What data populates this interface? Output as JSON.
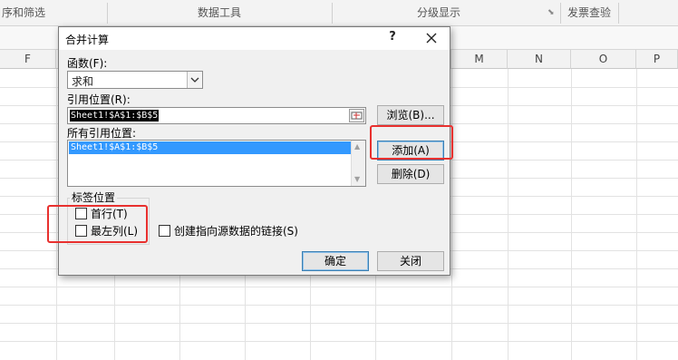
{
  "ribbon": {
    "groups": [
      "序和筛选",
      "数据工具",
      "分级显示",
      "发票查验"
    ]
  },
  "sheet": {
    "columns": [
      "F",
      "M",
      "N",
      "O",
      "P"
    ]
  },
  "dialog": {
    "title": "合并计算",
    "help": "?",
    "function_label": "函数(F):",
    "function_value": "求和",
    "reference_label": "引用位置(R):",
    "reference_value": "Sheet1!$A$1:$B$5",
    "browse_label": "浏览(B)...",
    "all_references_label": "所有引用位置:",
    "all_references": [
      "Sheet1!$A$1:$B$5"
    ],
    "add_label": "添加(A)",
    "delete_label": "删除(D)",
    "use_labels_title": "标签位置",
    "top_row_label": "首行(T)",
    "top_row_checked": false,
    "left_column_label": "最左列(L)",
    "left_column_checked": false,
    "link_label": "创建指向源数据的链接(S)",
    "link_checked": false,
    "ok_label": "确定",
    "close_label": "关闭"
  },
  "colors": {
    "highlight_box": "#e8302e",
    "selection": "#3399ff"
  }
}
